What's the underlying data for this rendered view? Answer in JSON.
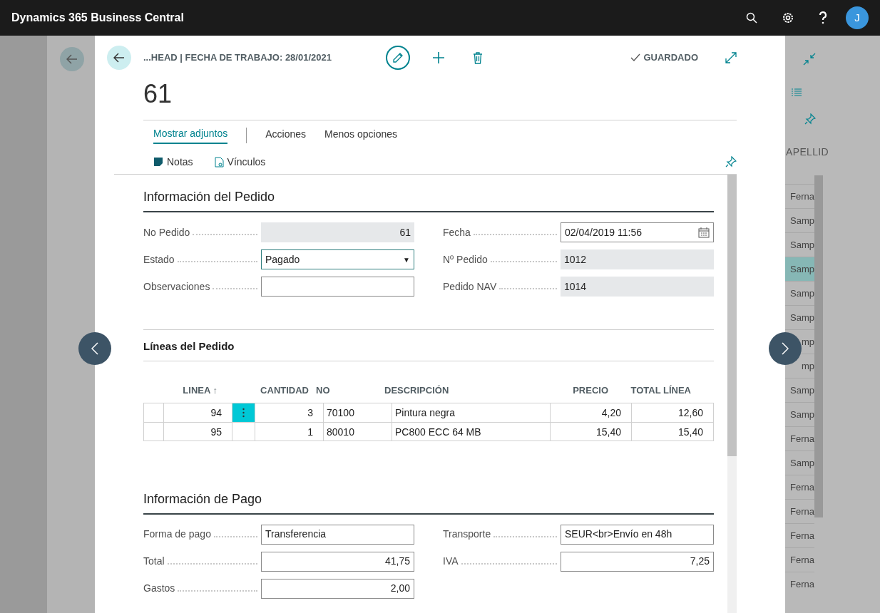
{
  "app_bar": {
    "title": "Dynamics 365 Business Central",
    "avatar": "J"
  },
  "background_list": {
    "column": "APELLID",
    "rows": [
      {
        "text": "Ferna",
        "selected": false
      },
      {
        "text": "Samp",
        "selected": false
      },
      {
        "text": "Samp",
        "selected": false
      },
      {
        "text": "Samp",
        "selected": true
      },
      {
        "text": "Samp",
        "selected": false
      },
      {
        "text": "Samp",
        "selected": false
      },
      {
        "text": "mp",
        "selected": false
      },
      {
        "text": "mp",
        "selected": false
      },
      {
        "text": "Samp",
        "selected": false
      },
      {
        "text": "Samp",
        "selected": false
      },
      {
        "text": "Ferna",
        "selected": false
      },
      {
        "text": "Samp",
        "selected": false
      },
      {
        "text": "Ferna",
        "selected": false
      },
      {
        "text": "Ferna",
        "selected": false
      },
      {
        "text": "Ferna",
        "selected": false
      },
      {
        "text": "Ferna",
        "selected": false
      },
      {
        "text": "Ferna",
        "selected": false
      }
    ]
  },
  "card": {
    "breadcrumb": "...HEAD | FECHA DE TRABAJO: 28/01/2021",
    "status": "GUARDADO",
    "title": "61",
    "tabs": [
      {
        "label": "Mostrar adjuntos",
        "selected": true
      },
      {
        "label": "Acciones",
        "selected": false
      },
      {
        "label": "Menos opciones",
        "selected": false
      }
    ],
    "actions": [
      "Notas",
      "Vínculos"
    ],
    "order_info": {
      "title": "Información del Pedido",
      "fields": [
        {
          "label": "No Pedido",
          "value": "61",
          "kind": "counter"
        },
        {
          "label": "Fecha",
          "value": "02/04/2019 11:56",
          "kind": "date"
        },
        {
          "label": "Estado",
          "value": "Pagado",
          "kind": "select",
          "caret": "▼"
        },
        {
          "label": "Nº Pedido",
          "value": "1012",
          "kind": "readonly"
        },
        {
          "label": "Observaciones",
          "kind": "text"
        },
        {
          "label": "Pedido NAV",
          "value": "1014",
          "kind": "readonly"
        }
      ]
    },
    "lines": {
      "title": "Líneas del Pedido",
      "columns": [
        "LINEA ↑",
        "CANTIDAD",
        "NO",
        "DESCRIPCIÓN",
        "PRECIO",
        "TOTAL LÍNEA"
      ],
      "rows": [
        {
          "linea": "94",
          "cantidad": "3",
          "no": "70100",
          "descripcion": "Pintura negra",
          "precio": "4,20",
          "total": "12,60",
          "selected": true
        },
        {
          "linea": "95",
          "cantidad": "1",
          "no": "80010",
          "descripcion": "PC800 ECC 64 MB",
          "precio": "15,40",
          "total": "15,40",
          "selected": false
        }
      ]
    },
    "payment_info": {
      "title": "Información de Pago",
      "fields": [
        {
          "label": "Forma de pago",
          "value": "Transferencia",
          "kind": "text"
        },
        {
          "label": "Transporte",
          "value": "SEUR<br>Envío en 48h",
          "kind": "text"
        },
        {
          "label": "Total",
          "value": "41,75",
          "kind": "amount"
        },
        {
          "label": "IVA",
          "value": "7,25",
          "kind": "amount"
        },
        {
          "label": "Gastos",
          "value": "2,00",
          "kind": "amount"
        }
      ]
    }
  }
}
